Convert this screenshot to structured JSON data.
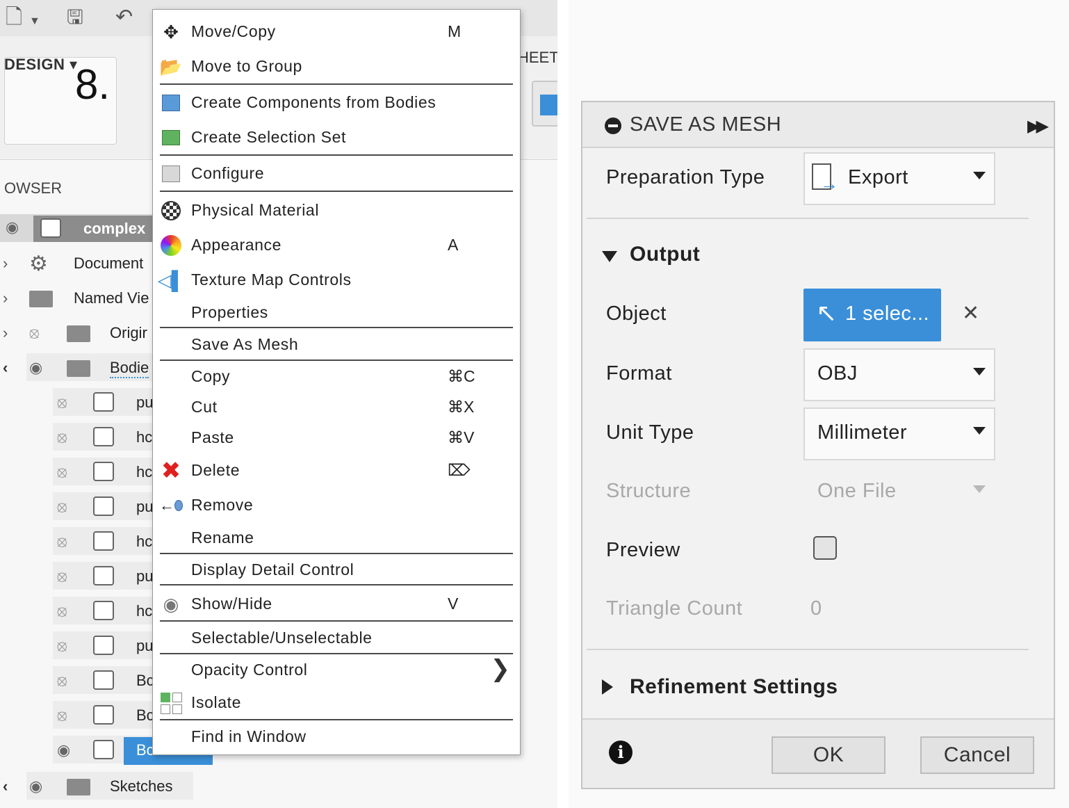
{
  "left_panel": {
    "ribbon": {
      "workspace_label": "DESIGN ▾",
      "workspace_number": "8.",
      "sheet_tab_label": "HEET"
    },
    "browser": {
      "title": "OWSER",
      "root_label": "complex",
      "rows": [
        {
          "label": "Document"
        },
        {
          "label": "Named Vie"
        },
        {
          "label": "Origir"
        },
        {
          "label": "Bodie"
        },
        {
          "label": "pu"
        },
        {
          "label": "hc"
        },
        {
          "label": "hc"
        },
        {
          "label": "pu"
        },
        {
          "label": "hc"
        },
        {
          "label": "pu"
        },
        {
          "label": "hc"
        },
        {
          "label": "pu"
        },
        {
          "label": "Bc"
        },
        {
          "label": "Bc"
        },
        {
          "label": "Bc"
        },
        {
          "label": "Sketches"
        }
      ]
    },
    "context_menu": {
      "items": [
        {
          "label": "Move/Copy",
          "shortcut": "M",
          "icon": "move-arrows-icon"
        },
        {
          "label": "Move to Group",
          "shortcut": "",
          "icon": "folder-open-icon"
        },
        {
          "label": "Create Components from Bodies",
          "shortcut": "",
          "icon": "create-components-icon"
        },
        {
          "label": "Create Selection Set",
          "shortcut": "",
          "icon": "selection-set-icon"
        },
        {
          "label": "Configure",
          "shortcut": "",
          "icon": "configure-icon"
        },
        {
          "label": "Physical Material",
          "shortcut": "",
          "icon": "physical-material-icon"
        },
        {
          "label": "Appearance",
          "shortcut": "A",
          "icon": "appearance-icon"
        },
        {
          "label": "Texture Map Controls",
          "shortcut": "",
          "icon": "texture-map-icon"
        },
        {
          "label": "Properties",
          "shortcut": "",
          "icon": ""
        },
        {
          "label": "Save As Mesh",
          "shortcut": "",
          "icon": ""
        },
        {
          "label": "Copy",
          "shortcut": "⌘C",
          "icon": ""
        },
        {
          "label": "Cut",
          "shortcut": "⌘X",
          "icon": ""
        },
        {
          "label": "Paste",
          "shortcut": "⌘V",
          "icon": ""
        },
        {
          "label": "Delete",
          "shortcut": "⌦",
          "icon": "delete-x-icon"
        },
        {
          "label": "Remove",
          "shortcut": "",
          "icon": "remove-icon"
        },
        {
          "label": "Rename",
          "shortcut": "",
          "icon": ""
        },
        {
          "label": "Display Detail Control",
          "shortcut": "",
          "icon": ""
        },
        {
          "label": "Show/Hide",
          "shortcut": "V",
          "icon": "eye-icon"
        },
        {
          "label": "Selectable/Unselectable",
          "shortcut": "",
          "icon": ""
        },
        {
          "label": "Opacity Control",
          "shortcut": "",
          "icon": "",
          "submenu": "❯"
        },
        {
          "label": "Isolate",
          "shortcut": "",
          "icon": "isolate-icon"
        },
        {
          "label": "Find in Window",
          "shortcut": "",
          "icon": ""
        }
      ]
    }
  },
  "dialog": {
    "title": "SAVE AS MESH",
    "expand_icon": "double-arrow-right-icon",
    "preparation_type": {
      "label": "Preparation Type",
      "value": "Export"
    },
    "output_section": {
      "title": "Output"
    },
    "object": {
      "label": "Object",
      "value": "1 selec..."
    },
    "format": {
      "label": "Format",
      "value": "OBJ"
    },
    "unit_type": {
      "label": "Unit Type",
      "value": "Millimeter"
    },
    "structure": {
      "label": "Structure",
      "value": "One File"
    },
    "preview": {
      "label": "Preview",
      "checked": false
    },
    "triangle_count": {
      "label": "Triangle Count",
      "value": "0"
    },
    "refinement_section": {
      "title": "Refinement Settings"
    },
    "buttons": {
      "ok": "OK",
      "cancel": "Cancel"
    },
    "colors": {
      "accent": "#3a8fd8",
      "disabled_text": "#a8a8a8"
    }
  }
}
